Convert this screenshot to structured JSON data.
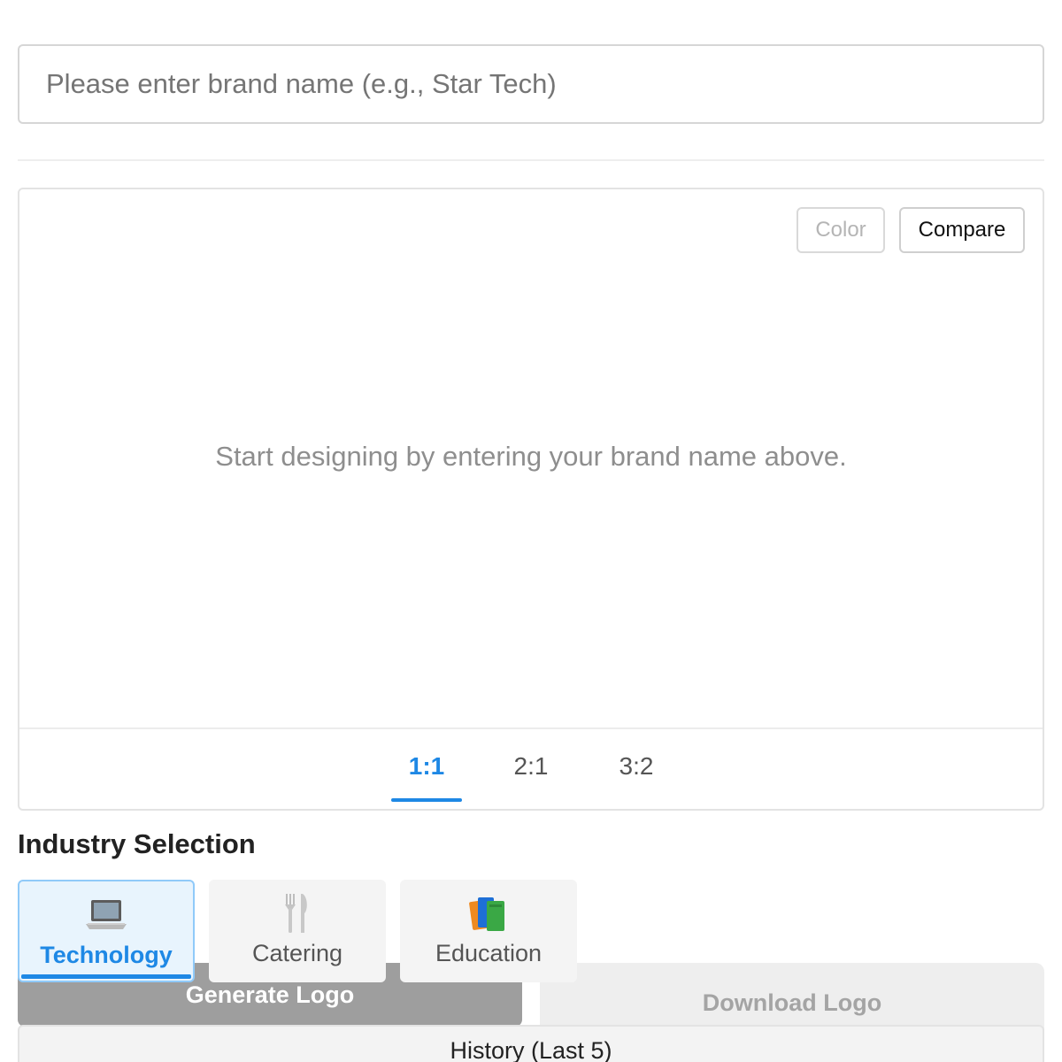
{
  "brand_input": {
    "placeholder": "Please enter brand name (e.g., Star Tech)",
    "value": ""
  },
  "preview": {
    "color_label": "Color",
    "compare_label": "Compare",
    "placeholder": "Start designing by entering your brand name above.",
    "ratios": [
      {
        "label": "1:1",
        "active": true
      },
      {
        "label": "2:1",
        "active": false
      },
      {
        "label": "3:2",
        "active": false
      }
    ]
  },
  "industry": {
    "title": "Industry Selection",
    "options": [
      {
        "label": "Technology",
        "icon": "laptop-icon",
        "selected": true
      },
      {
        "label": "Catering",
        "icon": "fork-knife-icon",
        "selected": false
      },
      {
        "label": "Education",
        "icon": "books-icon",
        "selected": false
      }
    ]
  },
  "actions": {
    "generate_label": "Generate Logo",
    "download_label": "Download Logo"
  },
  "history": {
    "label": "History (Last 5)"
  },
  "colors": {
    "accent": "#1e88e5",
    "generate_bg": "#9e9e9e",
    "download_bg": "#eeeeee"
  }
}
